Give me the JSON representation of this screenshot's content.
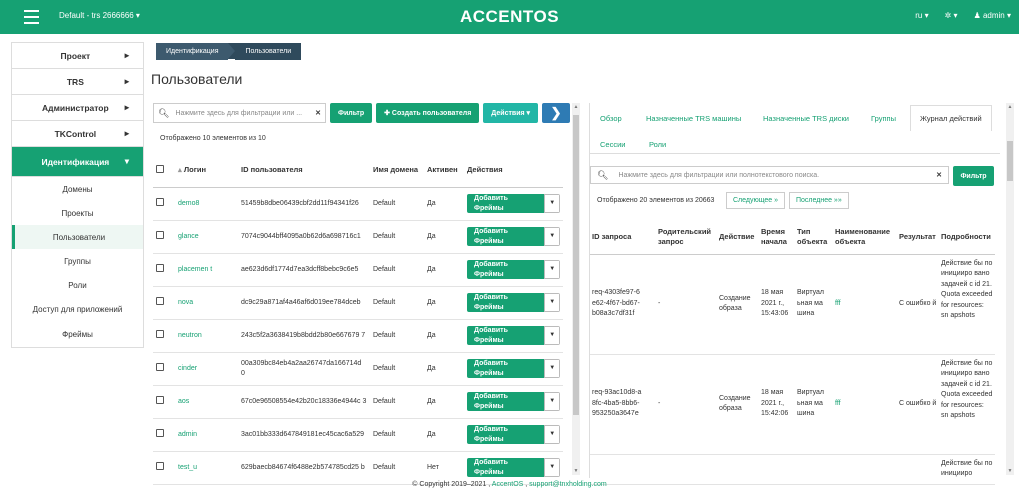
{
  "topbar": {
    "project": "Default - trs 2666666 ▾",
    "logo": "ACCENTOS",
    "lang": "ru ▾",
    "settings": "✲ ▾",
    "user": "admin ▾"
  },
  "sidebar": {
    "items": [
      {
        "label": "Проект",
        "arrow": "▸"
      },
      {
        "label": "TRS",
        "arrow": "▸"
      },
      {
        "label": "Администратор",
        "arrow": "▸"
      },
      {
        "label": "TKControl",
        "arrow": "▸"
      },
      {
        "label": "Идентификация",
        "arrow": "▾"
      }
    ],
    "sub": [
      "Домены",
      "Проекты",
      "Пользователи",
      "Группы",
      "Роли",
      "Доступ для приложений",
      "Фреймы"
    ]
  },
  "breadcrumb": [
    "Идентификация",
    "Пользователи"
  ],
  "page_title": "Пользователи",
  "toolbar": {
    "search_placeholder": "Нажмите здесь для фильтрации или ...",
    "clear": "✕",
    "filter": "Фильтр",
    "create": "✚ Создать пользователя",
    "actions": "Действия ▾",
    "next": "❯"
  },
  "count_left": "Отображено 10 элементов из 10",
  "users_table": {
    "headers": [
      "Логин",
      "ID пользователя",
      "Имя домена",
      "Активен",
      "Действия"
    ],
    "sort_icon": "▴",
    "add_label": "Добавить Фреймы",
    "add_dd": "▼",
    "rows": [
      {
        "login": "demo8",
        "id": "51459b8dbe06439cbf2dd11f94341f26",
        "domain": "Default",
        "active": "Да"
      },
      {
        "login": "glance",
        "id": "7074c9044bff4095a0b62d6a698716c1",
        "domain": "Default",
        "active": "Да"
      },
      {
        "login": "placemen t",
        "id": "ae623d6df1774d7ea3dcff8bebc9c6e5",
        "domain": "Default",
        "active": "Да"
      },
      {
        "login": "nova",
        "id": "dc9c29a871af4a46af6d019ee784dceb",
        "domain": "Default",
        "active": "Да"
      },
      {
        "login": "neutron",
        "id": "243c5f2a3638419b8bdd2b80e667679 7",
        "domain": "Default",
        "active": "Да"
      },
      {
        "login": "cinder",
        "id": "00a309bc84eb4a2aa26747da166714d 0",
        "domain": "Default",
        "active": "Да"
      },
      {
        "login": "aos",
        "id": "67c0e96508554e42b20c18336e4944c 3",
        "domain": "Default",
        "active": "Да"
      },
      {
        "login": "admin",
        "id": "3ac01bb333d647849181ec45cac6a529",
        "domain": "Default",
        "active": "Да"
      },
      {
        "login": "test_u",
        "id": "629baecb84674f6488e2b574785cd25 b",
        "domain": "Default",
        "active": "Нет"
      }
    ]
  },
  "right_panel": {
    "tabs": [
      "Обзор",
      "Назначенные TRS машины",
      "Назначенные TRS диски",
      "Группы",
      "Журнал действий",
      "Сессии",
      "Роли"
    ],
    "search_placeholder": "Нажмите здесь для фильтрации или полнотекстового поиска.",
    "clear": "✕",
    "filter": "Фильтр",
    "count": "Отображено 20 элементов из 20663",
    "next": "Следующее »",
    "last": "Последнее »»",
    "log_headers": [
      "ID запроса",
      "Родительский запрос",
      "Действие",
      "Время начала",
      "Тип объекта",
      "Наименование объекта",
      "Результат",
      "Подробности"
    ],
    "log_rows": [
      {
        "req": "req-4303fe97-6 e62-4f67-bd67- b08a3c7df31f",
        "parent": "-",
        "action": "Создание образа",
        "time": "18 мая 2021 г., 15:43:06",
        "otype": "Виртуал ьная ма шина",
        "oname": "fff",
        "result": "С ошибко й",
        "details": "Действие бы по иницииро вано задачей с id 21. Quota exceeded for resources: sn apshots"
      },
      {
        "req": "req-93ac10d8-a 8fc-4ba5-8bb6- 953250a3647e",
        "parent": "-",
        "action": "Создание образа",
        "time": "18 мая 2021 г., 15:42:06",
        "otype": "Виртуал ьная ма шина",
        "oname": "fff",
        "result": "С ошибко й",
        "details": "Действие бы по иницииро вано задачей с id 21. Quota exceeded for resources: sn apshots"
      },
      {
        "req": "",
        "parent": "",
        "action": "",
        "time": "",
        "otype": "",
        "oname": "",
        "result": "",
        "details": "Действие бы по иницииро"
      }
    ]
  },
  "footer": {
    "prefix": "© Copyright 2019–2021 , ",
    "brand": "AccentOS",
    "sep": " , ",
    "email": "support@tnxholding.com"
  },
  "colors": {
    "accent": "#16a173",
    "breadcrumb": "#3d5a6e",
    "blue": "#2e7bb4"
  }
}
